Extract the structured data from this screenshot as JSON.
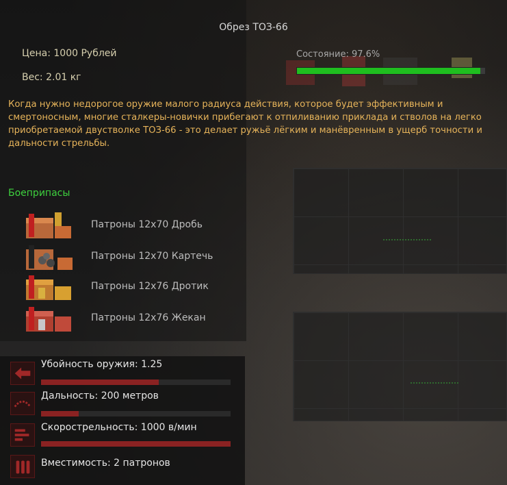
{
  "item": {
    "title": "Обрез ТОЗ-66",
    "price": "Цена: 1000 Рублей",
    "weight": "Вес: 2.01 кг",
    "condition_label": "Состояние: 97.6%",
    "condition_value": 0.976,
    "description": "Когда нужно недорогое оружие малого радиуса действия, которое будет эффективным и смертоносным, многие сталкеры-новички прибегают к отпиливанию приклада и стволов на легко приобретаемой двустволке ТОЗ-66 - это делает ружьё лёгким и манёвренным в ущерб точности и дальности стрельбы."
  },
  "ammo": {
    "heading": "Боеприпасы",
    "items": [
      {
        "label": "Патроны 12х70 Дробь",
        "icon": "buckshot-box-icon"
      },
      {
        "label": "Патроны 12х70 Картечь",
        "icon": "grapeshot-box-icon"
      },
      {
        "label": "Патроны 12х76 Дротик",
        "icon": "dart-box-icon"
      },
      {
        "label": "Патроны 12х76 Жекан",
        "icon": "slug-box-icon"
      }
    ]
  },
  "stats": [
    {
      "label": "Убойность оружия: 1.25",
      "icon": "damage-icon",
      "value": 0.62
    },
    {
      "label": "Дальность: 200 метров",
      "icon": "range-icon",
      "value": 0.2
    },
    {
      "label": "Скорострельность: 1000 в/мин",
      "icon": "fire-rate-icon",
      "value": 1.0
    },
    {
      "label": "Вместимость: 2 патронов",
      "icon": "capacity-icon",
      "value": 0.0
    }
  ],
  "colors": {
    "condition": "#1fbe1f",
    "description": "#e7b45a",
    "ammo_heading": "#3ed13e",
    "stat_bar": "#8a2222"
  }
}
